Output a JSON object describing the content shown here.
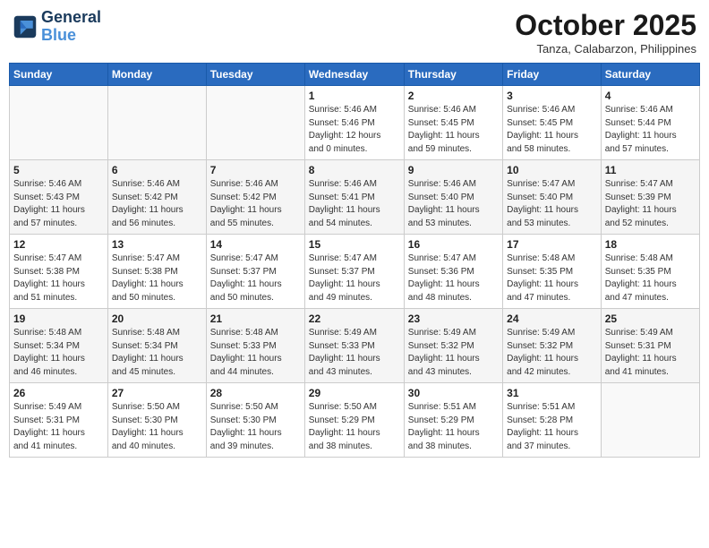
{
  "logo": {
    "line1": "General",
    "line2": "Blue"
  },
  "title": "October 2025",
  "location": "Tanza, Calabarzon, Philippines",
  "weekdays": [
    "Sunday",
    "Monday",
    "Tuesday",
    "Wednesday",
    "Thursday",
    "Friday",
    "Saturday"
  ],
  "weeks": [
    [
      {
        "day": "",
        "info": ""
      },
      {
        "day": "",
        "info": ""
      },
      {
        "day": "",
        "info": ""
      },
      {
        "day": "1",
        "info": "Sunrise: 5:46 AM\nSunset: 5:46 PM\nDaylight: 12 hours\nand 0 minutes."
      },
      {
        "day": "2",
        "info": "Sunrise: 5:46 AM\nSunset: 5:45 PM\nDaylight: 11 hours\nand 59 minutes."
      },
      {
        "day": "3",
        "info": "Sunrise: 5:46 AM\nSunset: 5:45 PM\nDaylight: 11 hours\nand 58 minutes."
      },
      {
        "day": "4",
        "info": "Sunrise: 5:46 AM\nSunset: 5:44 PM\nDaylight: 11 hours\nand 57 minutes."
      }
    ],
    [
      {
        "day": "5",
        "info": "Sunrise: 5:46 AM\nSunset: 5:43 PM\nDaylight: 11 hours\nand 57 minutes."
      },
      {
        "day": "6",
        "info": "Sunrise: 5:46 AM\nSunset: 5:42 PM\nDaylight: 11 hours\nand 56 minutes."
      },
      {
        "day": "7",
        "info": "Sunrise: 5:46 AM\nSunset: 5:42 PM\nDaylight: 11 hours\nand 55 minutes."
      },
      {
        "day": "8",
        "info": "Sunrise: 5:46 AM\nSunset: 5:41 PM\nDaylight: 11 hours\nand 54 minutes."
      },
      {
        "day": "9",
        "info": "Sunrise: 5:46 AM\nSunset: 5:40 PM\nDaylight: 11 hours\nand 53 minutes."
      },
      {
        "day": "10",
        "info": "Sunrise: 5:47 AM\nSunset: 5:40 PM\nDaylight: 11 hours\nand 53 minutes."
      },
      {
        "day": "11",
        "info": "Sunrise: 5:47 AM\nSunset: 5:39 PM\nDaylight: 11 hours\nand 52 minutes."
      }
    ],
    [
      {
        "day": "12",
        "info": "Sunrise: 5:47 AM\nSunset: 5:38 PM\nDaylight: 11 hours\nand 51 minutes."
      },
      {
        "day": "13",
        "info": "Sunrise: 5:47 AM\nSunset: 5:38 PM\nDaylight: 11 hours\nand 50 minutes."
      },
      {
        "day": "14",
        "info": "Sunrise: 5:47 AM\nSunset: 5:37 PM\nDaylight: 11 hours\nand 50 minutes."
      },
      {
        "day": "15",
        "info": "Sunrise: 5:47 AM\nSunset: 5:37 PM\nDaylight: 11 hours\nand 49 minutes."
      },
      {
        "day": "16",
        "info": "Sunrise: 5:47 AM\nSunset: 5:36 PM\nDaylight: 11 hours\nand 48 minutes."
      },
      {
        "day": "17",
        "info": "Sunrise: 5:48 AM\nSunset: 5:35 PM\nDaylight: 11 hours\nand 47 minutes."
      },
      {
        "day": "18",
        "info": "Sunrise: 5:48 AM\nSunset: 5:35 PM\nDaylight: 11 hours\nand 47 minutes."
      }
    ],
    [
      {
        "day": "19",
        "info": "Sunrise: 5:48 AM\nSunset: 5:34 PM\nDaylight: 11 hours\nand 46 minutes."
      },
      {
        "day": "20",
        "info": "Sunrise: 5:48 AM\nSunset: 5:34 PM\nDaylight: 11 hours\nand 45 minutes."
      },
      {
        "day": "21",
        "info": "Sunrise: 5:48 AM\nSunset: 5:33 PM\nDaylight: 11 hours\nand 44 minutes."
      },
      {
        "day": "22",
        "info": "Sunrise: 5:49 AM\nSunset: 5:33 PM\nDaylight: 11 hours\nand 43 minutes."
      },
      {
        "day": "23",
        "info": "Sunrise: 5:49 AM\nSunset: 5:32 PM\nDaylight: 11 hours\nand 43 minutes."
      },
      {
        "day": "24",
        "info": "Sunrise: 5:49 AM\nSunset: 5:32 PM\nDaylight: 11 hours\nand 42 minutes."
      },
      {
        "day": "25",
        "info": "Sunrise: 5:49 AM\nSunset: 5:31 PM\nDaylight: 11 hours\nand 41 minutes."
      }
    ],
    [
      {
        "day": "26",
        "info": "Sunrise: 5:49 AM\nSunset: 5:31 PM\nDaylight: 11 hours\nand 41 minutes."
      },
      {
        "day": "27",
        "info": "Sunrise: 5:50 AM\nSunset: 5:30 PM\nDaylight: 11 hours\nand 40 minutes."
      },
      {
        "day": "28",
        "info": "Sunrise: 5:50 AM\nSunset: 5:30 PM\nDaylight: 11 hours\nand 39 minutes."
      },
      {
        "day": "29",
        "info": "Sunrise: 5:50 AM\nSunset: 5:29 PM\nDaylight: 11 hours\nand 38 minutes."
      },
      {
        "day": "30",
        "info": "Sunrise: 5:51 AM\nSunset: 5:29 PM\nDaylight: 11 hours\nand 38 minutes."
      },
      {
        "day": "31",
        "info": "Sunrise: 5:51 AM\nSunset: 5:28 PM\nDaylight: 11 hours\nand 37 minutes."
      },
      {
        "day": "",
        "info": ""
      }
    ]
  ]
}
